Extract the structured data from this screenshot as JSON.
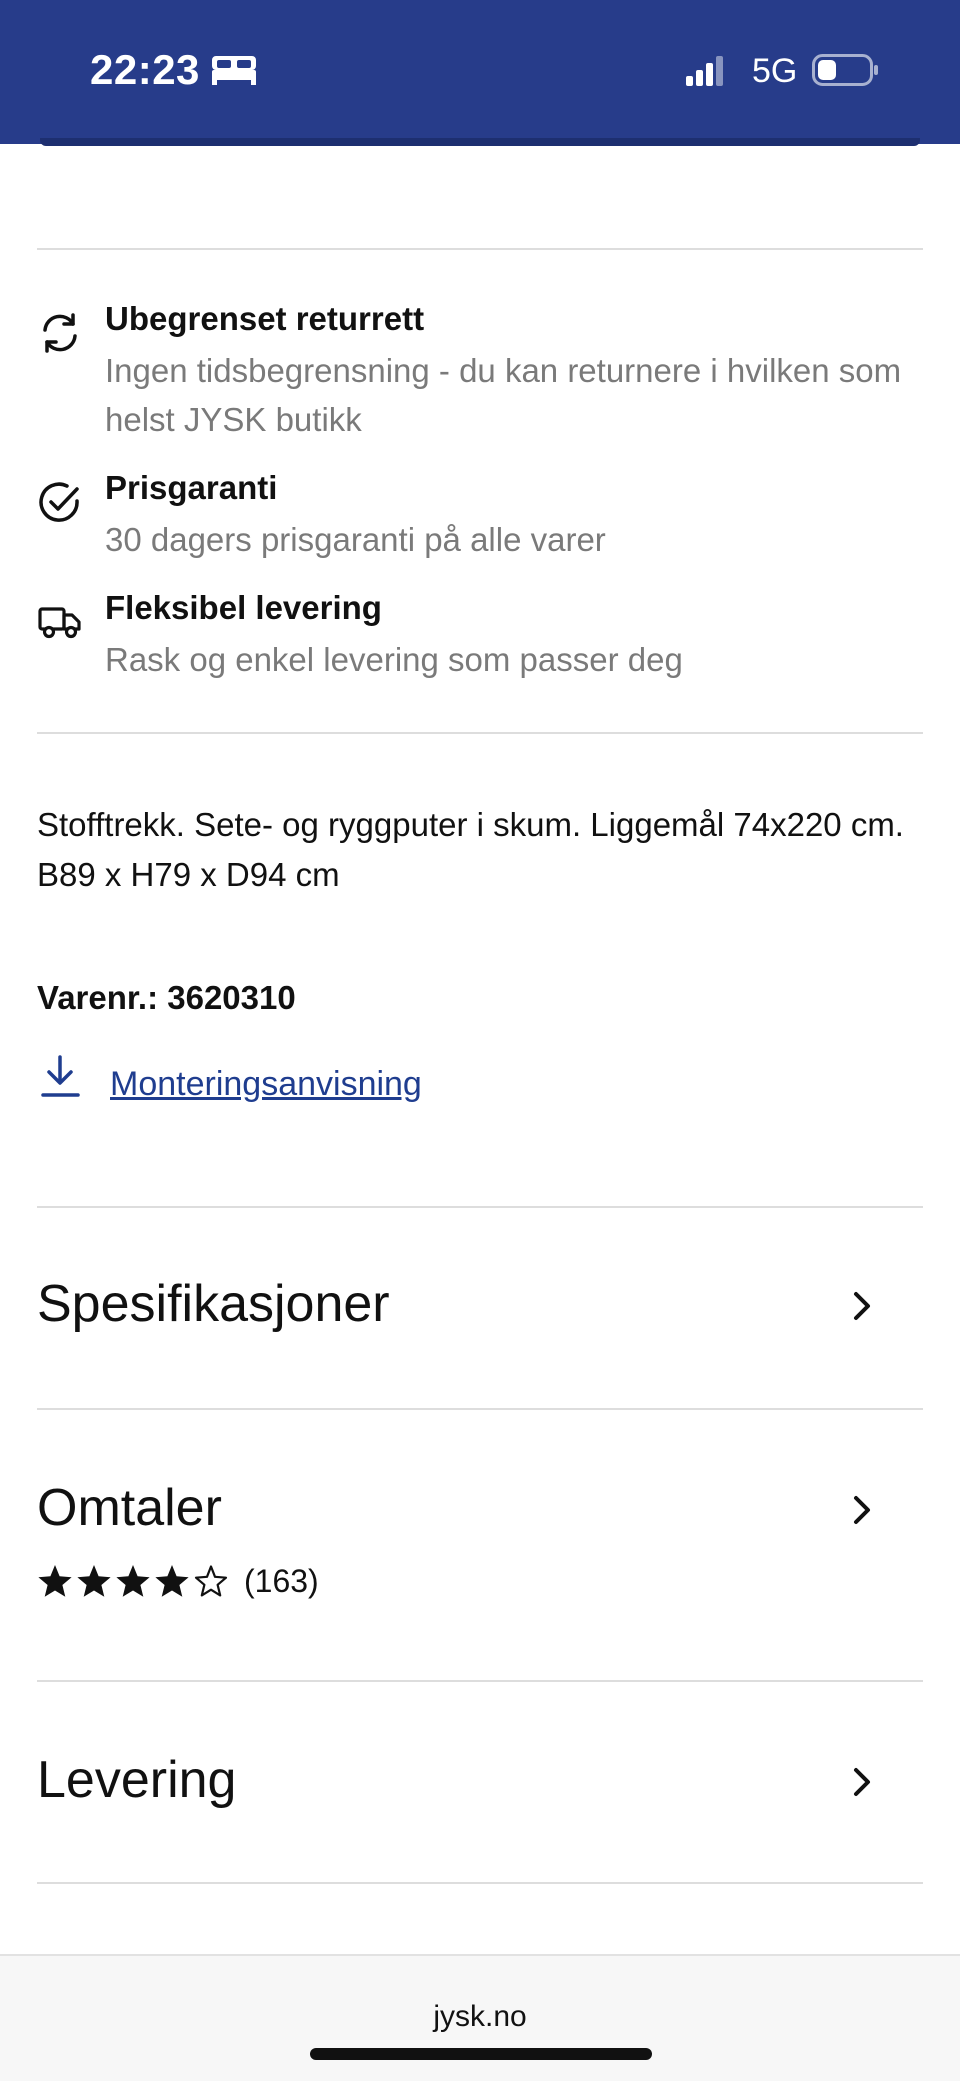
{
  "status_bar": {
    "time": "22:23",
    "network": "5G",
    "icons": [
      "bed-icon",
      "signal-icon",
      "battery-icon"
    ]
  },
  "benefits": [
    {
      "icon": "refresh-icon",
      "title": "Ubegrenset returrett",
      "description": "Ingen tidsbegrensning - du kan returnere i hvilken som helst JYSK butikk"
    },
    {
      "icon": "check-circle-icon",
      "title": "Prisgaranti",
      "description": "30 dagers prisgaranti på alle varer"
    },
    {
      "icon": "truck-icon",
      "title": "Fleksibel levering",
      "description": "Rask og enkel levering som passer deg"
    }
  ],
  "product": {
    "description": "Stofftrekk. Sete- og ryggputer i skum. Liggemål 74x220 cm. B89 x H79 x D94 cm",
    "article_number": "Varenr.: 3620310",
    "assembly_link": "Monteringsanvisning"
  },
  "sections": {
    "specifications": "Spesifikasjoner",
    "reviews": "Omtaler",
    "delivery": "Levering"
  },
  "reviews": {
    "rating": 4,
    "max_rating": 5,
    "count_label": "(163)"
  },
  "browser": {
    "url": "jysk.no"
  },
  "colors": {
    "brand_blue": "#273c8a",
    "link_blue": "#1f3d8f",
    "muted_text": "#7a7a7a"
  }
}
